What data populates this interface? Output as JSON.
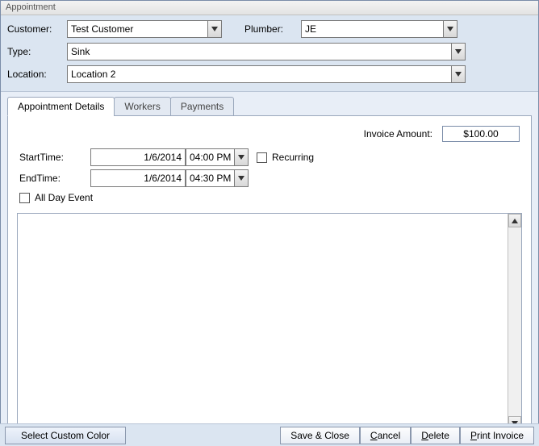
{
  "title": "Appointment",
  "header": {
    "customer_label": "Customer:",
    "customer_value": "Test Customer",
    "plumber_label": "Plumber:",
    "plumber_value": "JE",
    "type_label": "Type:",
    "type_value": "Sink",
    "location_label": "Location:",
    "location_value": "Location 2"
  },
  "tabs": {
    "details": "Appointment Details",
    "workers": "Workers",
    "payments": "Payments"
  },
  "details": {
    "invoice_label": "Invoice Amount:",
    "invoice_value": "$100.00",
    "start_label": "StartTime:",
    "start_date": "1/6/2014",
    "start_time": "04:00 PM",
    "end_label": "EndTime:",
    "end_date": "1/6/2014",
    "end_time": "04:30 PM",
    "recurring_label": "Recurring",
    "allday_label": "All Day Event",
    "notes": ""
  },
  "footer": {
    "select_color": "Select Custom Color",
    "save_close": "Save & Close",
    "cancel_rest": "ancel",
    "delete_rest": "elete",
    "print_rest": "rint Invoice"
  }
}
